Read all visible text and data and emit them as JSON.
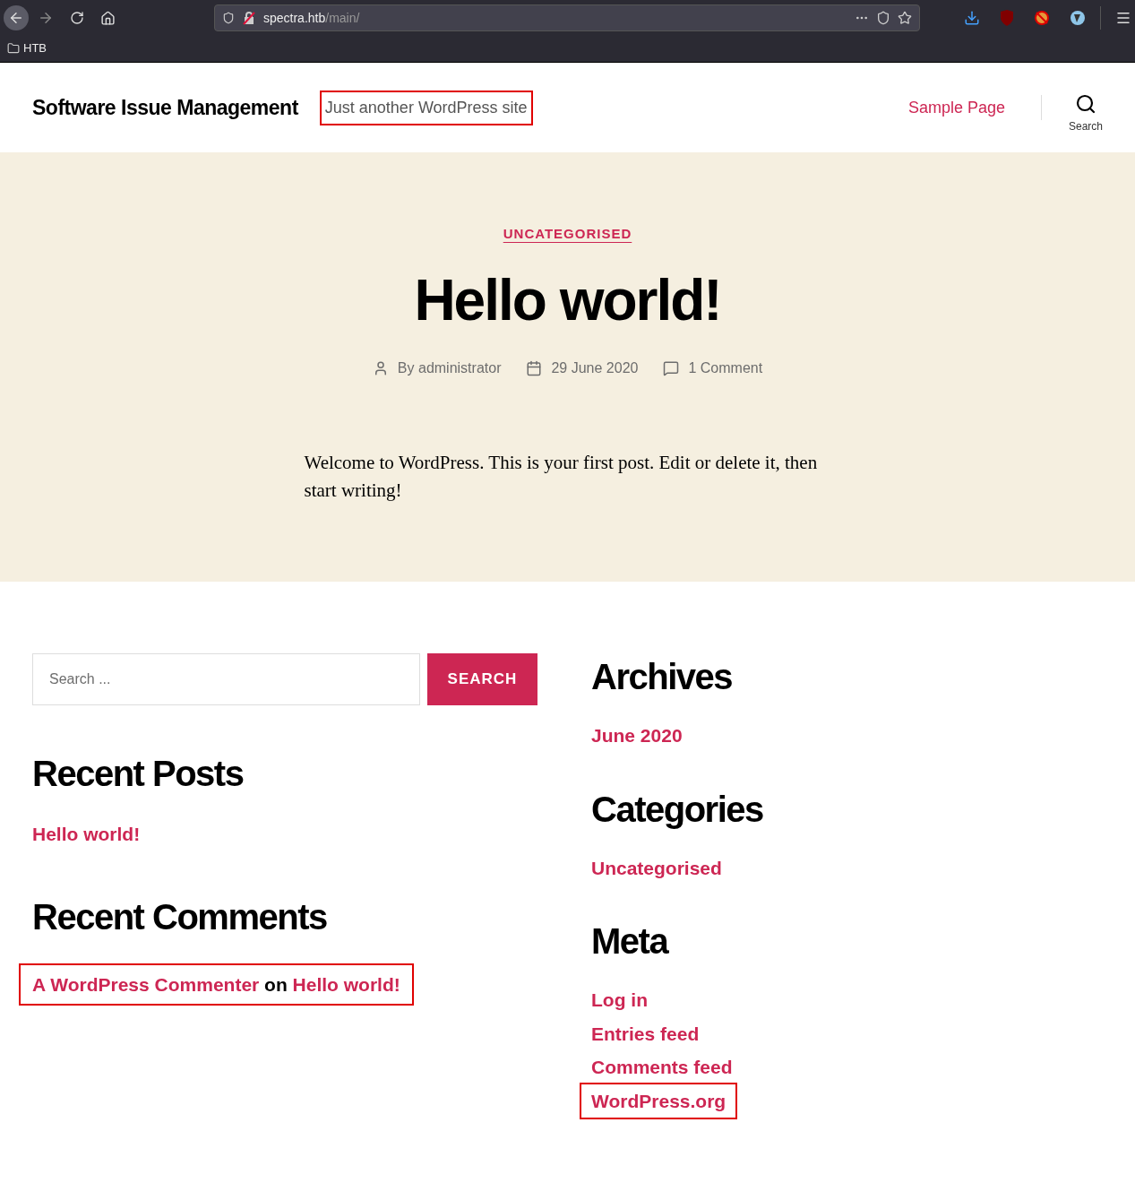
{
  "browser": {
    "url_host": "spectra.htb",
    "url_path": "/main/",
    "bookmarks": [
      {
        "label": "HTB"
      }
    ]
  },
  "site": {
    "title": "Software Issue Management",
    "tagline": "Just another WordPress site",
    "tagline_highlighted": true,
    "nav": [
      {
        "label": "Sample Page"
      }
    ],
    "search_label": "Search"
  },
  "post": {
    "category": "UNCATEGORISED",
    "title": "Hello world!",
    "author": "By administrator",
    "date": "29 June 2020",
    "comments": "1 Comment",
    "body": "Welcome to WordPress. This is your first post. Edit or delete it, then start writing!"
  },
  "search": {
    "placeholder": "Search ...",
    "button": "SEARCH"
  },
  "left_widgets": [
    {
      "title": "Recent Posts",
      "links": [
        {
          "text": "Hello world!",
          "highlighted": false
        }
      ]
    },
    {
      "title": "Recent Comments",
      "comment": {
        "author": "A WordPress Commenter",
        "joiner": "on",
        "post": "Hello world!",
        "highlighted": true
      }
    }
  ],
  "right_widgets": [
    {
      "title": "Archives",
      "links": [
        {
          "text": "June 2020",
          "highlighted": false
        }
      ]
    },
    {
      "title": "Categories",
      "links": [
        {
          "text": "Uncategorised",
          "highlighted": false
        }
      ]
    },
    {
      "title": "Meta",
      "links": [
        {
          "text": "Log in",
          "highlighted": false
        },
        {
          "text": "Entries feed",
          "highlighted": false
        },
        {
          "text": "Comments feed",
          "highlighted": false
        },
        {
          "text": "WordPress.org",
          "highlighted": true
        }
      ]
    }
  ]
}
